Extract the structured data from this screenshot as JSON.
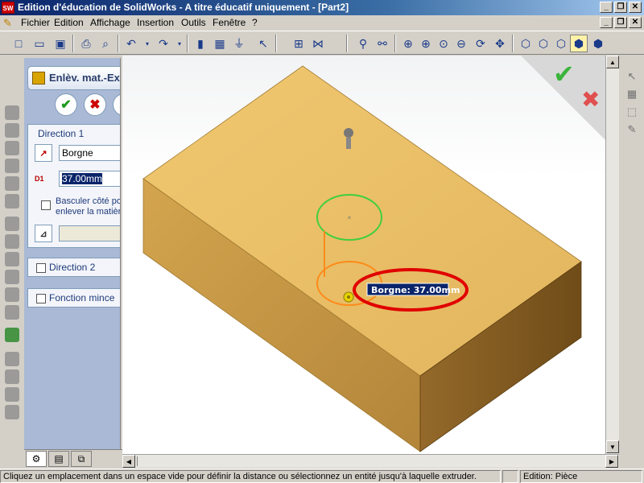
{
  "window": {
    "app_logo": "SW",
    "title": "Edition d'éducation de SolidWorks - A titre éducatif uniquement - [Part2]"
  },
  "menu": {
    "items": [
      "Fichier",
      "Edition",
      "Affichage",
      "Insertion",
      "Outils",
      "Fenêtre",
      "?"
    ]
  },
  "property_manager": {
    "title": "Enlèv. mat.-Extr.",
    "ok_symbol": "✔",
    "cancel_symbol": "✖",
    "direction1": {
      "title": "Direction 1",
      "end_condition": "Borgne",
      "depth_label": "D1",
      "depth_value": "37.00mm",
      "flip_side_label_line1": "Basculer côté pour",
      "flip_side_label_line2": "enlever la matière",
      "draft_value": ""
    },
    "direction2_title": "Direction 2",
    "thin_feature_title": "Fonction mince"
  },
  "viewport": {
    "dimension_callout": "Borgne: 37.00mm",
    "accept_symbol": "✔",
    "reject_symbol": "✖",
    "colors": {
      "top_face": "#e8c06a",
      "left_face": "#c89a45",
      "right_face": "#8a6224",
      "green_circle": "#3fcf3f",
      "orange_circle": "#ff8a1a",
      "highlight_ring": "#e00000"
    }
  },
  "statusbar": {
    "message": "Cliquez un emplacement dans un espace vide pour définir la distance ou sélectionnez un entité jusqu'à laquelle extruder.",
    "mode": "Edition: Pièce"
  }
}
